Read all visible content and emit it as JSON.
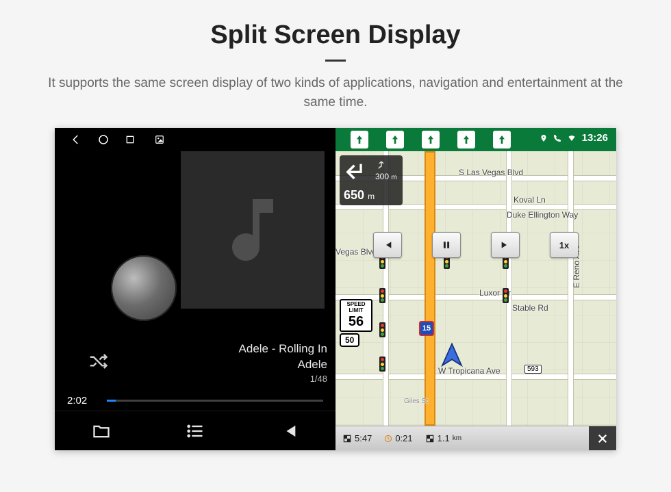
{
  "header": {
    "title": "Split Screen Display",
    "subtitle": "It supports the same screen display of two kinds of applications, navigation and entertainment at the same time."
  },
  "statusbar": {
    "time": "13:26",
    "lanes_count": 5
  },
  "music": {
    "track_title": "Adele - Rolling In",
    "track_artist": "Adele",
    "track_index": "1/48",
    "elapsed": "2:02"
  },
  "nav": {
    "turn": {
      "next_distance": "300",
      "next_unit": "m",
      "total_distance": "650",
      "total_unit": "m"
    },
    "speed_limit_label": "SPEED LIMIT",
    "speed_limit_value": "56",
    "route_shield": "50",
    "highway_shield": "15",
    "media_speed": "1x",
    "streets": {
      "s_las_vegas_blvd": "S Las Vegas Blvd",
      "koval_ln": "Koval Ln",
      "duke_ellington": "Duke Ellington Way",
      "vegas_blvd": "Vegas Blvd",
      "luxor_dr": "Luxor Dr",
      "stable_rd": "Stable Rd",
      "e_reno_ave": "E Reno Ave",
      "w_tropicana": "W Tropicana Ave",
      "giles_st": "Giles St"
    },
    "exits": {
      "593": "593"
    },
    "bottom": {
      "eta": "5:47",
      "remaining_time": "0:21",
      "remaining_dist": "1.1",
      "remaining_dist_unit": "km"
    }
  }
}
